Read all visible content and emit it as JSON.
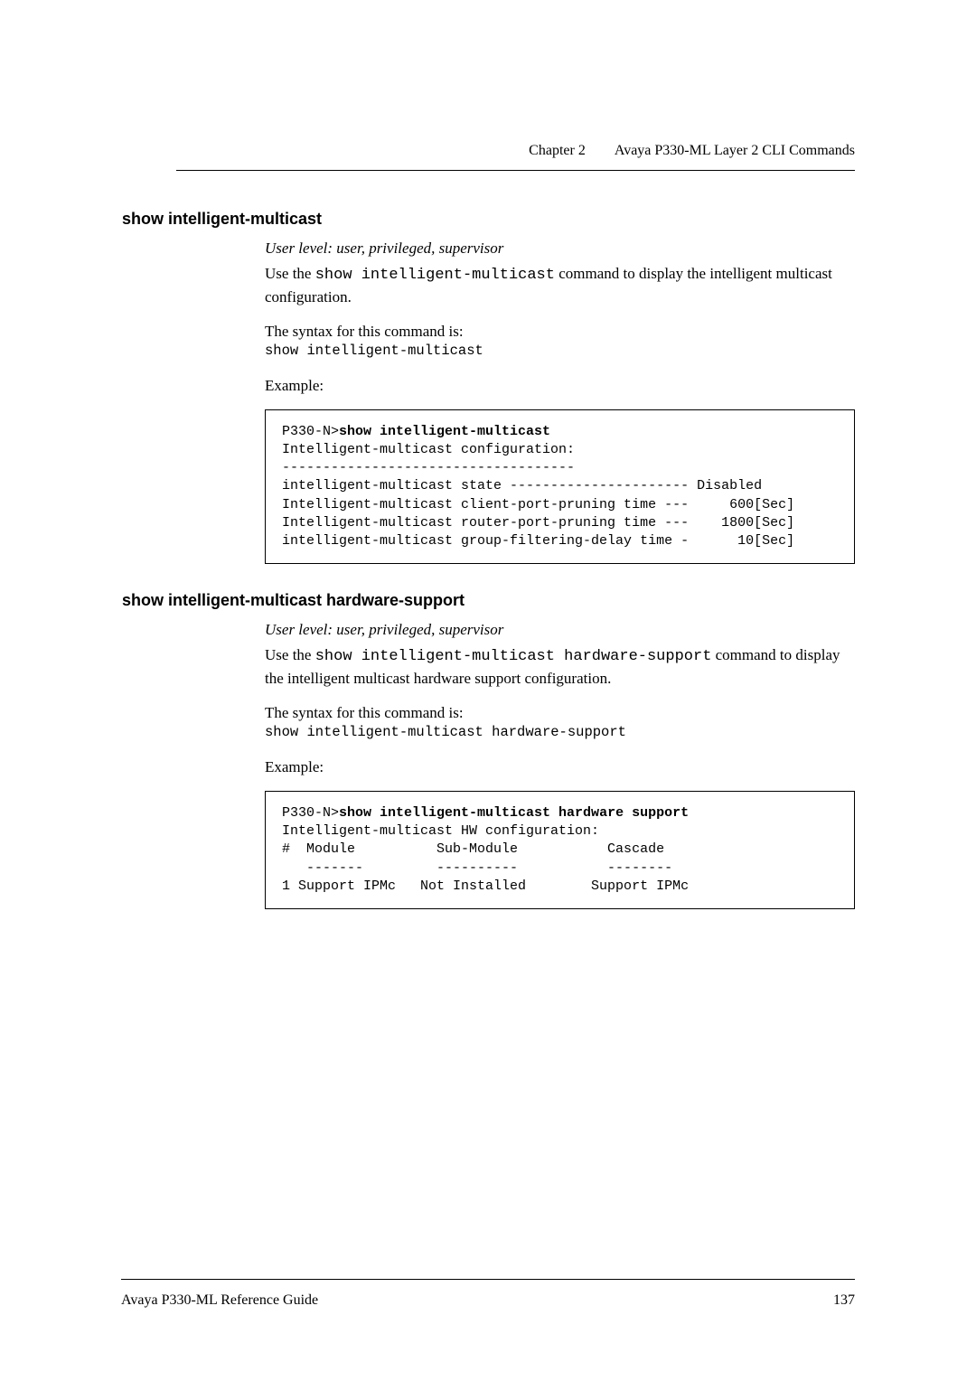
{
  "header": {
    "chapter": "Chapter 2",
    "title": "Avaya P330-ML Layer 2 CLI Commands"
  },
  "section1": {
    "title": "show intelligent-multicast",
    "user_level": "User level: user, privileged, supervisor",
    "use_pre": "Use the ",
    "use_cmd": "show intelligent-multicast",
    "use_post": " command to display the intelligent multicast configuration.",
    "syntax_label": "The syntax for this command is:",
    "syntax": "show intelligent-multicast",
    "example_label": "Example:",
    "code_prompt": "P330-N>",
    "code_cmd": "show intelligent-multicast",
    "code_line1": "Intelligent-multicast configuration:",
    "code_line2": "------------------------------------",
    "code_line3": "intelligent-multicast state ---------------------- Disabled",
    "code_line4": "Intelligent-multicast client-port-pruning time ---     600[Sec]",
    "code_line5": "Intelligent-multicast router-port-pruning time ---    1800[Sec]",
    "code_line6": "intelligent-multicast group-filtering-delay time -      10[Sec]"
  },
  "section2": {
    "title": "show intelligent-multicast hardware-support",
    "user_level": "User level: user, privileged, supervisor",
    "use_pre": "Use the ",
    "use_cmd": "show intelligent-multicast hardware-support",
    "use_post": " command to display the intelligent multicast hardware support configuration.",
    "syntax_label": "The syntax for this command is:",
    "syntax": "show intelligent-multicast hardware-support",
    "example_label": "Example:",
    "code_prompt": "P330-N>",
    "code_cmd": "show intelligent-multicast hardware support",
    "code_line1": "Intelligent-multicast HW configuration:",
    "code_line2": "#  Module          Sub-Module           Cascade",
    "code_line3": "   -------         ----------           --------",
    "code_line4": "1 Support IPMc   Not Installed        Support IPMc"
  },
  "footer": {
    "left": "Avaya P330-ML Reference Guide",
    "page": "137"
  }
}
